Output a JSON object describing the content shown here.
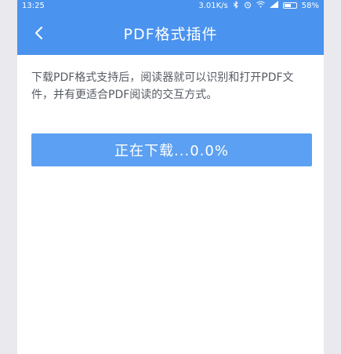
{
  "status_bar": {
    "time": "13:25",
    "network_speed": "3.01K/s",
    "battery_level": "58%",
    "icons": [
      "bluetooth-icon",
      "alarm-icon",
      "wifi-icon",
      "signal-icon",
      "battery-icon"
    ],
    "battery_fraction": 0.58
  },
  "header": {
    "title": "PDF格式插件",
    "back_icon": "chevron-left-icon"
  },
  "content": {
    "description": "下载PDF格式支持后，阅读器就可以识别和打开PDF文件，并有更适合PDF阅读的交互方式。"
  },
  "download": {
    "label": "正在下载...0.0%"
  },
  "colors": {
    "primary": "#4a93ee",
    "button": "#5ba0f2",
    "text": "#555b63",
    "backdrop": "#e9e9ee"
  }
}
